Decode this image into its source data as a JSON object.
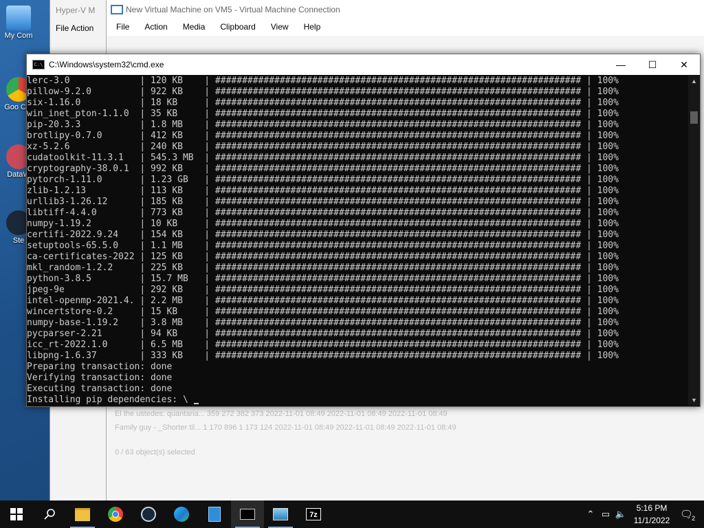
{
  "desktop": {
    "icons": [
      {
        "label": "My Com"
      },
      {
        "label": "Goo Chr"
      },
      {
        "label": "DataW"
      },
      {
        "label": "Ste"
      }
    ]
  },
  "hyperv_manager": {
    "title": "Hyper-V M",
    "menu": "File  Action"
  },
  "vm_connection": {
    "title": "New Virtual Machine on VM5 - Virtual Machine Connection",
    "menu": [
      "File",
      "Action",
      "Media",
      "Clipboard",
      "View",
      "Help"
    ],
    "ghost_rows": [
      "El the ustedes: quantaria...   359 272   382 373   2022-11-01 08:49   2022-11-01 08:49   2022-11-01 08:49",
      "Family guy - _Shorter til...   1 170 896   1 173 124   2022-11-01 08:49   2022-11-01 08:49   2022-11-01 08:49"
    ],
    "ghost_status": "0 / 63 object(s) selected"
  },
  "cmd": {
    "title": "C:\\Windows\\system32\\cmd.exe",
    "minimize": "—",
    "maximize": "☐",
    "close": "✕",
    "progress_bar": "####################################################################",
    "packages": [
      {
        "name": "lerc-3.0",
        "size": "120 KB",
        "pct": "100%"
      },
      {
        "name": "pillow-9.2.0",
        "size": "922 KB",
        "pct": "100%"
      },
      {
        "name": "six-1.16.0",
        "size": "18 KB",
        "pct": "100%"
      },
      {
        "name": "win_inet_pton-1.1.0",
        "size": "35 KB",
        "pct": "100%"
      },
      {
        "name": "pip-20.3.3",
        "size": "1.8 MB",
        "pct": "100%"
      },
      {
        "name": "brotlipy-0.7.0",
        "size": "412 KB",
        "pct": "100%"
      },
      {
        "name": "xz-5.2.6",
        "size": "240 KB",
        "pct": "100%"
      },
      {
        "name": "cudatoolkit-11.3.1",
        "size": "545.3 MB",
        "pct": "100%"
      },
      {
        "name": "cryptography-38.0.1",
        "size": "992 KB",
        "pct": "100%"
      },
      {
        "name": "pytorch-1.11.0",
        "size": "1.23 GB",
        "pct": "100%"
      },
      {
        "name": "zlib-1.2.13",
        "size": "113 KB",
        "pct": "100%"
      },
      {
        "name": "urllib3-1.26.12",
        "size": "185 KB",
        "pct": "100%"
      },
      {
        "name": "libtiff-4.4.0",
        "size": "773 KB",
        "pct": "100%"
      },
      {
        "name": "numpy-1.19.2",
        "size": "10 KB",
        "pct": "100%"
      },
      {
        "name": "certifi-2022.9.24",
        "size": "154 KB",
        "pct": "100%"
      },
      {
        "name": "setuptools-65.5.0",
        "size": "1.1 MB",
        "pct": "100%"
      },
      {
        "name": "ca-certificates-2022",
        "size": "125 KB",
        "pct": "100%"
      },
      {
        "name": "mkl_random-1.2.2",
        "size": "225 KB",
        "pct": "100%"
      },
      {
        "name": "python-3.8.5",
        "size": "15.7 MB",
        "pct": "100%"
      },
      {
        "name": "jpeg-9e",
        "size": "292 KB",
        "pct": "100%"
      },
      {
        "name": "intel-openmp-2021.4.",
        "size": "2.2 MB",
        "pct": "100%"
      },
      {
        "name": "wincertstore-0.2",
        "size": "15 KB",
        "pct": "100%"
      },
      {
        "name": "numpy-base-1.19.2",
        "size": "3.8 MB",
        "pct": "100%"
      },
      {
        "name": "pycparser-2.21",
        "size": "94 KB",
        "pct": "100%"
      },
      {
        "name": "icc_rt-2022.1.0",
        "size": "6.5 MB",
        "pct": "100%"
      },
      {
        "name": "libpng-1.6.37",
        "size": "333 KB",
        "pct": "100%"
      }
    ],
    "status_lines": [
      "Preparing transaction: done",
      "Verifying transaction: done",
      "Executing transaction: done"
    ],
    "prompt_line": "Installing pip dependencies: \\ "
  },
  "taskbar": {
    "apps": [
      {
        "name": "start-icon"
      },
      {
        "name": "search-icon"
      },
      {
        "name": "file-explorer-icon"
      },
      {
        "name": "chrome-icon"
      },
      {
        "name": "steam-icon"
      },
      {
        "name": "edge-icon"
      },
      {
        "name": "building-app-icon"
      },
      {
        "name": "cmd-icon"
      },
      {
        "name": "hyperv-manager-icon"
      },
      {
        "name": "7zip-icon"
      }
    ],
    "time": "5:16 PM",
    "date": "11/1/2022",
    "notifications_count": "2"
  }
}
